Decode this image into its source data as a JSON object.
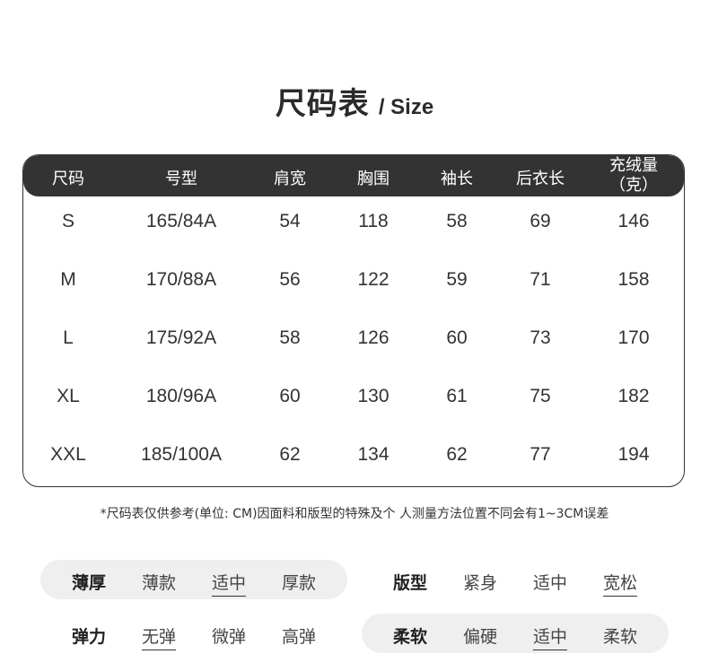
{
  "title": {
    "main": "尺码表",
    "sub": "/ Size"
  },
  "table": {
    "headers": [
      "尺码",
      "号型",
      "肩宽",
      "胸围",
      "袖长",
      "后衣长",
      "充绒量",
      "（克）"
    ],
    "rows": [
      [
        "S",
        "165/84A",
        "54",
        "118",
        "58",
        "69",
        "146"
      ],
      [
        "M",
        "170/88A",
        "56",
        "122",
        "59",
        "71",
        "158"
      ],
      [
        "L",
        "175/92A",
        "58",
        "126",
        "60",
        "73",
        "170"
      ],
      [
        "XL",
        "180/96A",
        "60",
        "130",
        "61",
        "75",
        "182"
      ],
      [
        "XXL",
        "185/100A",
        "62",
        "134",
        "62",
        "77",
        "194"
      ]
    ]
  },
  "note": "*尺码表仅供参考(单位: CM)因面料和版型的特殊及个 人测量方法位置不同会有1~3CM误差",
  "attributes": {
    "thickness": {
      "label": "薄厚",
      "options": [
        "薄款",
        "适中",
        "厚款"
      ],
      "selected": "适中"
    },
    "fit": {
      "label": "版型",
      "options": [
        "紧身",
        "适中",
        "宽松"
      ],
      "selected": "宽松"
    },
    "elasticity": {
      "label": "弹力",
      "options": [
        "无弹",
        "微弹",
        "高弹"
      ],
      "selected": "无弹"
    },
    "softness": {
      "label": "柔软",
      "options": [
        "偏硬",
        "适中",
        "柔软"
      ],
      "selected": "适中"
    }
  },
  "colors": {
    "header_bg": "#333333",
    "header_text": "#ffffff",
    "pill_bg": "#efefef"
  }
}
